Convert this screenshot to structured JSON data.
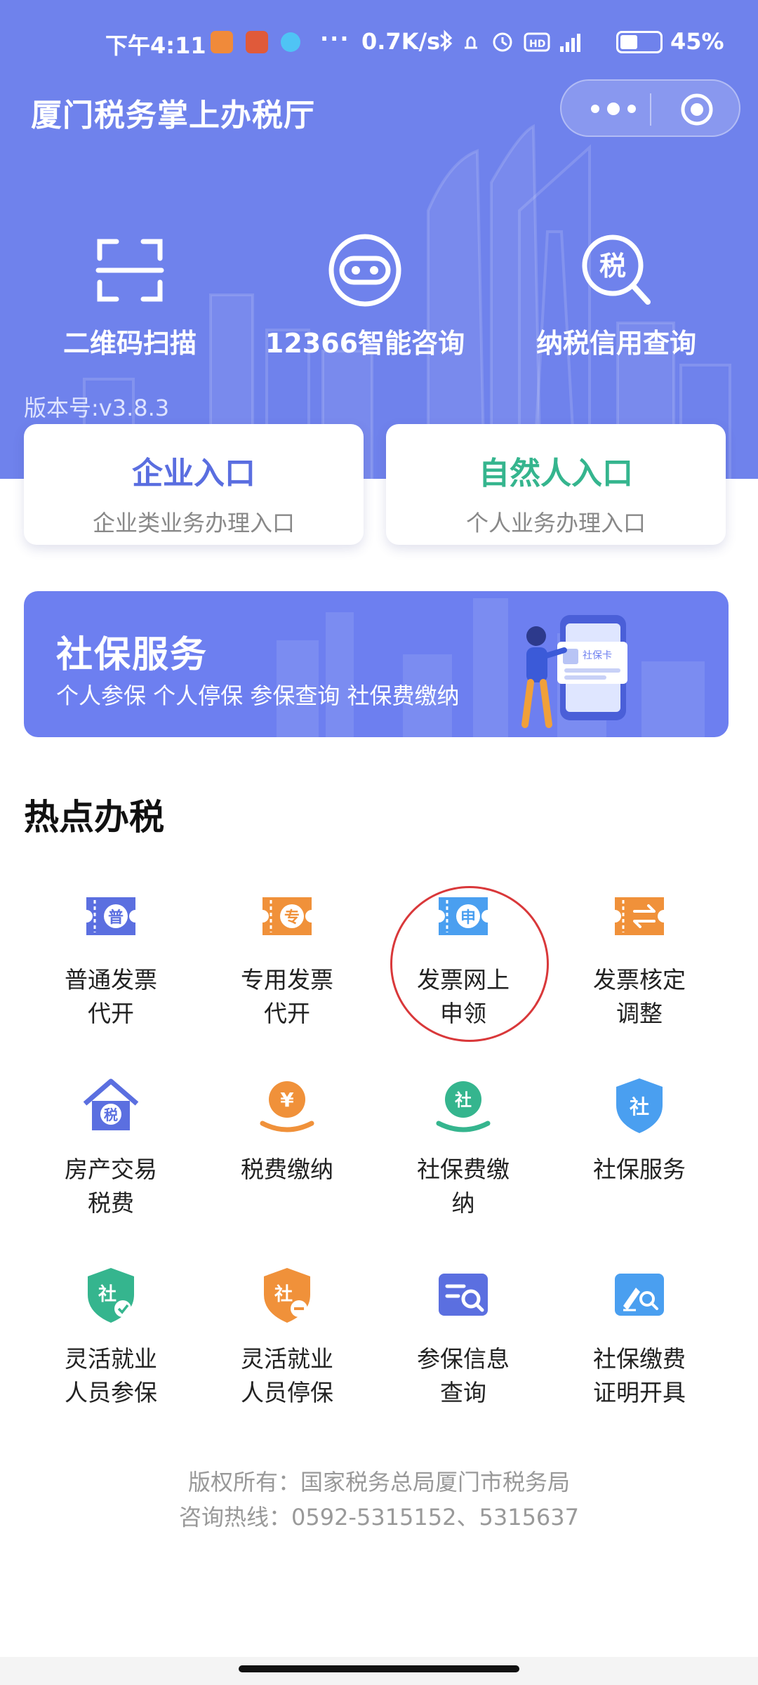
{
  "status_bar": {
    "time": "下午4:11",
    "dots": "···",
    "net_speed": "0.7K/s",
    "battery": "45%"
  },
  "header": {
    "title": "厦门税务掌上办税厅",
    "menu_icon": "more-dots-icon",
    "close_icon": "target-circle-icon"
  },
  "quick_actions": [
    {
      "label": "二维码扫描",
      "icon": "qr-scan-icon"
    },
    {
      "label": "12366智能咨询",
      "icon": "robot-chat-icon"
    },
    {
      "label": "纳税信用查询",
      "icon": "tax-search-icon"
    }
  ],
  "version": "版本号:v3.8.3",
  "entries": [
    {
      "title": "企业入口",
      "subtitle": "企业类业务办理入口",
      "color": "#5a6ee0"
    },
    {
      "title": "自然人入口",
      "subtitle": "个人业务办理入口",
      "color": "#35b58e"
    }
  ],
  "banner": {
    "title": "社保服务",
    "subtitle": "个人参保 个人停保 参保查询 社保费缴纳",
    "card_text": "社保卡"
  },
  "section_title": "热点办税",
  "grid": [
    {
      "label": "普通发票\n代开",
      "glyph": "普",
      "icon": "ticket-icon",
      "color": "#5b6fe0"
    },
    {
      "label": "专用发票\n代开",
      "glyph": "专",
      "icon": "ticket-icon",
      "color": "#f0913a"
    },
    {
      "label": "发票网上\n申领",
      "glyph": "申",
      "icon": "ticket-icon",
      "color": "#4a9ff0"
    },
    {
      "label": "发票核定\n调整",
      "glyph": "⇄",
      "icon": "ticket-swap-icon",
      "color": "#f0913a"
    },
    {
      "label": "房产交易\n税费",
      "glyph": "税",
      "icon": "house-tax-icon",
      "color": "#5b6fe0"
    },
    {
      "label": "税费缴纳",
      "glyph": "¥",
      "icon": "yen-hand-icon",
      "color": "#f0913a"
    },
    {
      "label": "社保费缴\n纳",
      "glyph": "社",
      "icon": "social-hand-icon",
      "color": "#35b58e"
    },
    {
      "label": "社保服务",
      "glyph": "社",
      "icon": "shield-icon",
      "color": "#4a9ff0"
    },
    {
      "label": "灵活就业\n人员参保",
      "glyph": "社",
      "icon": "shield-check-icon",
      "color": "#35b58e"
    },
    {
      "label": "灵活就业\n人员停保",
      "glyph": "社",
      "icon": "shield-minus-icon",
      "color": "#f0913a"
    },
    {
      "label": "参保信息\n查询",
      "glyph": "",
      "icon": "doc-search-icon",
      "color": "#5b6fe0"
    },
    {
      "label": "社保缴费\n证明开具",
      "glyph": "",
      "icon": "doc-edit-icon",
      "color": "#4a9ff0"
    }
  ],
  "footer": {
    "line1": "版权所有：国家税务总局厦门市税务局",
    "line2": "咨询热线：0592-5315152、5315637"
  }
}
